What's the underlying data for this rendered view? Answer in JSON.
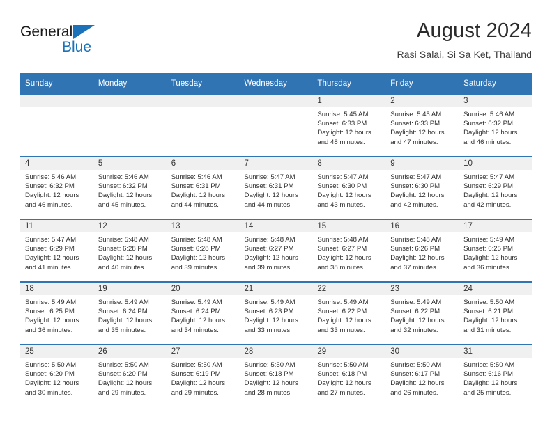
{
  "brand": {
    "name_top": "General",
    "name_bottom": "Blue",
    "accent_color": "#1b72b8"
  },
  "header": {
    "title": "August 2024",
    "subtitle": "Rasi Salai, Si Sa Ket, Thailand"
  },
  "calendar": {
    "header_bg": "#3174b4",
    "daynum_bg": "#f0f0f0",
    "weekdays": [
      "Sunday",
      "Monday",
      "Tuesday",
      "Wednesday",
      "Thursday",
      "Friday",
      "Saturday"
    ],
    "weeks": [
      [
        {
          "day": "",
          "lines": []
        },
        {
          "day": "",
          "lines": []
        },
        {
          "day": "",
          "lines": []
        },
        {
          "day": "",
          "lines": []
        },
        {
          "day": "1",
          "lines": [
            "Sunrise: 5:45 AM",
            "Sunset: 6:33 PM",
            "Daylight: 12 hours",
            "and 48 minutes."
          ]
        },
        {
          "day": "2",
          "lines": [
            "Sunrise: 5:45 AM",
            "Sunset: 6:33 PM",
            "Daylight: 12 hours",
            "and 47 minutes."
          ]
        },
        {
          "day": "3",
          "lines": [
            "Sunrise: 5:46 AM",
            "Sunset: 6:32 PM",
            "Daylight: 12 hours",
            "and 46 minutes."
          ]
        }
      ],
      [
        {
          "day": "4",
          "lines": [
            "Sunrise: 5:46 AM",
            "Sunset: 6:32 PM",
            "Daylight: 12 hours",
            "and 46 minutes."
          ]
        },
        {
          "day": "5",
          "lines": [
            "Sunrise: 5:46 AM",
            "Sunset: 6:32 PM",
            "Daylight: 12 hours",
            "and 45 minutes."
          ]
        },
        {
          "day": "6",
          "lines": [
            "Sunrise: 5:46 AM",
            "Sunset: 6:31 PM",
            "Daylight: 12 hours",
            "and 44 minutes."
          ]
        },
        {
          "day": "7",
          "lines": [
            "Sunrise: 5:47 AM",
            "Sunset: 6:31 PM",
            "Daylight: 12 hours",
            "and 44 minutes."
          ]
        },
        {
          "day": "8",
          "lines": [
            "Sunrise: 5:47 AM",
            "Sunset: 6:30 PM",
            "Daylight: 12 hours",
            "and 43 minutes."
          ]
        },
        {
          "day": "9",
          "lines": [
            "Sunrise: 5:47 AM",
            "Sunset: 6:30 PM",
            "Daylight: 12 hours",
            "and 42 minutes."
          ]
        },
        {
          "day": "10",
          "lines": [
            "Sunrise: 5:47 AM",
            "Sunset: 6:29 PM",
            "Daylight: 12 hours",
            "and 42 minutes."
          ]
        }
      ],
      [
        {
          "day": "11",
          "lines": [
            "Sunrise: 5:47 AM",
            "Sunset: 6:29 PM",
            "Daylight: 12 hours",
            "and 41 minutes."
          ]
        },
        {
          "day": "12",
          "lines": [
            "Sunrise: 5:48 AM",
            "Sunset: 6:28 PM",
            "Daylight: 12 hours",
            "and 40 minutes."
          ]
        },
        {
          "day": "13",
          "lines": [
            "Sunrise: 5:48 AM",
            "Sunset: 6:28 PM",
            "Daylight: 12 hours",
            "and 39 minutes."
          ]
        },
        {
          "day": "14",
          "lines": [
            "Sunrise: 5:48 AM",
            "Sunset: 6:27 PM",
            "Daylight: 12 hours",
            "and 39 minutes."
          ]
        },
        {
          "day": "15",
          "lines": [
            "Sunrise: 5:48 AM",
            "Sunset: 6:27 PM",
            "Daylight: 12 hours",
            "and 38 minutes."
          ]
        },
        {
          "day": "16",
          "lines": [
            "Sunrise: 5:48 AM",
            "Sunset: 6:26 PM",
            "Daylight: 12 hours",
            "and 37 minutes."
          ]
        },
        {
          "day": "17",
          "lines": [
            "Sunrise: 5:49 AM",
            "Sunset: 6:25 PM",
            "Daylight: 12 hours",
            "and 36 minutes."
          ]
        }
      ],
      [
        {
          "day": "18",
          "lines": [
            "Sunrise: 5:49 AM",
            "Sunset: 6:25 PM",
            "Daylight: 12 hours",
            "and 36 minutes."
          ]
        },
        {
          "day": "19",
          "lines": [
            "Sunrise: 5:49 AM",
            "Sunset: 6:24 PM",
            "Daylight: 12 hours",
            "and 35 minutes."
          ]
        },
        {
          "day": "20",
          "lines": [
            "Sunrise: 5:49 AM",
            "Sunset: 6:24 PM",
            "Daylight: 12 hours",
            "and 34 minutes."
          ]
        },
        {
          "day": "21",
          "lines": [
            "Sunrise: 5:49 AM",
            "Sunset: 6:23 PM",
            "Daylight: 12 hours",
            "and 33 minutes."
          ]
        },
        {
          "day": "22",
          "lines": [
            "Sunrise: 5:49 AM",
            "Sunset: 6:22 PM",
            "Daylight: 12 hours",
            "and 33 minutes."
          ]
        },
        {
          "day": "23",
          "lines": [
            "Sunrise: 5:49 AM",
            "Sunset: 6:22 PM",
            "Daylight: 12 hours",
            "and 32 minutes."
          ]
        },
        {
          "day": "24",
          "lines": [
            "Sunrise: 5:50 AM",
            "Sunset: 6:21 PM",
            "Daylight: 12 hours",
            "and 31 minutes."
          ]
        }
      ],
      [
        {
          "day": "25",
          "lines": [
            "Sunrise: 5:50 AM",
            "Sunset: 6:20 PM",
            "Daylight: 12 hours",
            "and 30 minutes."
          ]
        },
        {
          "day": "26",
          "lines": [
            "Sunrise: 5:50 AM",
            "Sunset: 6:20 PM",
            "Daylight: 12 hours",
            "and 29 minutes."
          ]
        },
        {
          "day": "27",
          "lines": [
            "Sunrise: 5:50 AM",
            "Sunset: 6:19 PM",
            "Daylight: 12 hours",
            "and 29 minutes."
          ]
        },
        {
          "day": "28",
          "lines": [
            "Sunrise: 5:50 AM",
            "Sunset: 6:18 PM",
            "Daylight: 12 hours",
            "and 28 minutes."
          ]
        },
        {
          "day": "29",
          "lines": [
            "Sunrise: 5:50 AM",
            "Sunset: 6:18 PM",
            "Daylight: 12 hours",
            "and 27 minutes."
          ]
        },
        {
          "day": "30",
          "lines": [
            "Sunrise: 5:50 AM",
            "Sunset: 6:17 PM",
            "Daylight: 12 hours",
            "and 26 minutes."
          ]
        },
        {
          "day": "31",
          "lines": [
            "Sunrise: 5:50 AM",
            "Sunset: 6:16 PM",
            "Daylight: 12 hours",
            "and 25 minutes."
          ]
        }
      ]
    ]
  }
}
